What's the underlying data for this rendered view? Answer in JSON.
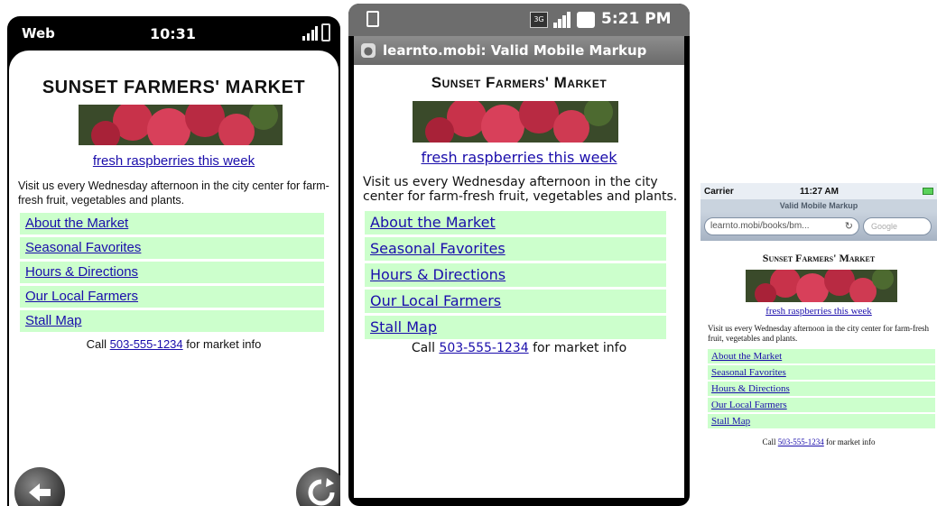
{
  "site": {
    "title": "Sunset Farmers' Market",
    "photo_link": "fresh raspberries this week",
    "intro": "Visit us every Wednesday afternoon in the city center for farm-fresh fruit, vegetables and plants.",
    "nav": [
      {
        "label": "About the Market"
      },
      {
        "label": "Seasonal Favorites"
      },
      {
        "label": "Hours & Directions"
      },
      {
        "label": "Our Local Farmers"
      },
      {
        "label": "Stall Map"
      }
    ],
    "call_prefix": "Call",
    "phone": "503-555-1234",
    "call_suffix": "for market info"
  },
  "palm": {
    "title": "SUNSET FARMERS' MARKET",
    "carrier": "Web",
    "time": "10:31",
    "icons": {
      "back": "back-arrow-icon",
      "reload": "reload-icon"
    }
  },
  "android": {
    "time": "5:21 PM",
    "indicator_3g": "3G",
    "page_title": "learnto.mobi: Valid Mobile Markup"
  },
  "iphone": {
    "carrier": "Carrier",
    "time": "11:27 AM",
    "page_title": "Valid Mobile Markup",
    "url": "learnto.mobi/books/bm...",
    "search_placeholder": "Google"
  },
  "colors": {
    "nav_bg": "#ccffcc",
    "link": "#1a0dab",
    "raspberry": "#c8324a"
  }
}
